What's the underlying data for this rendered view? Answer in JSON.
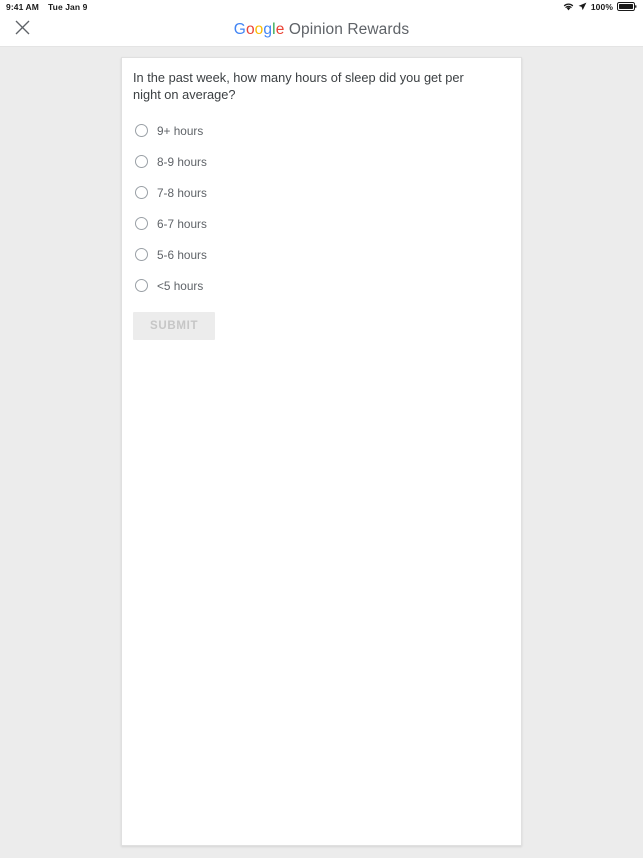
{
  "status_bar": {
    "time": "9:41 AM",
    "date": "Tue Jan 9",
    "wifi_icon": "wifi-icon",
    "location_icon": "location-arrow-icon",
    "battery_percent": "100%",
    "battery_icon": "battery-full-icon"
  },
  "header": {
    "close_icon": "close-icon",
    "brand": {
      "g_letters": [
        "G",
        "o",
        "o",
        "g",
        "l",
        "e"
      ],
      "suffix": " Opinion Rewards",
      "colors": {
        "blue": "#4285F4",
        "red": "#EA4335",
        "yellow": "#FBBC05",
        "green": "#34A853",
        "suffix_gray": "#5f6368"
      }
    }
  },
  "survey": {
    "question": "In the past week, how many hours of sleep did you get per night on average?",
    "options": [
      {
        "label": "9+ hours",
        "selected": false
      },
      {
        "label": "8-9 hours",
        "selected": false
      },
      {
        "label": "7-8 hours",
        "selected": false
      },
      {
        "label": "6-7 hours",
        "selected": false
      },
      {
        "label": "5-6 hours",
        "selected": false
      },
      {
        "label": "<5 hours",
        "selected": false
      }
    ],
    "submit_label": "SUBMIT",
    "submit_enabled": false
  }
}
